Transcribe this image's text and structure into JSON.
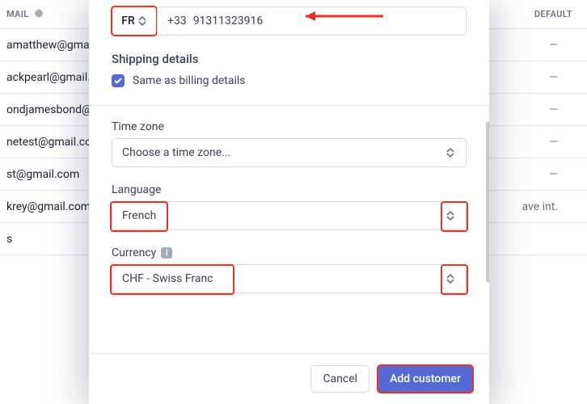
{
  "bg": {
    "col_email": "MAIL",
    "col_default": "DEFAULT",
    "dash": "—",
    "rows": [
      {
        "email": "amatthew@gmail.c",
        "default": "—"
      },
      {
        "email": "ackpearl@gmail.c",
        "default": "—"
      },
      {
        "email": "ondjamesbond@g",
        "default": "—"
      },
      {
        "email": "netest@gmail.co",
        "default": "—"
      },
      {
        "email": "st@gmail.com",
        "default": "—"
      },
      {
        "email": "krey@gmail.com",
        "default": "ave int."
      },
      {
        "email": "s",
        "default": ""
      }
    ]
  },
  "phone": {
    "country_code": "FR",
    "dial_prefix": "+33",
    "number": "91311323916"
  },
  "shipping": {
    "title": "Shipping details",
    "same_label": "Same as billing details",
    "same_checked": true
  },
  "timezone": {
    "label": "Time zone",
    "value": "Choose a time zone..."
  },
  "language": {
    "label": "Language",
    "value": "French"
  },
  "currency": {
    "label": "Currency",
    "value": "CHF - Swiss Franc"
  },
  "buttons": {
    "cancel": "Cancel",
    "submit": "Add customer"
  },
  "icons": {
    "info": "i"
  }
}
